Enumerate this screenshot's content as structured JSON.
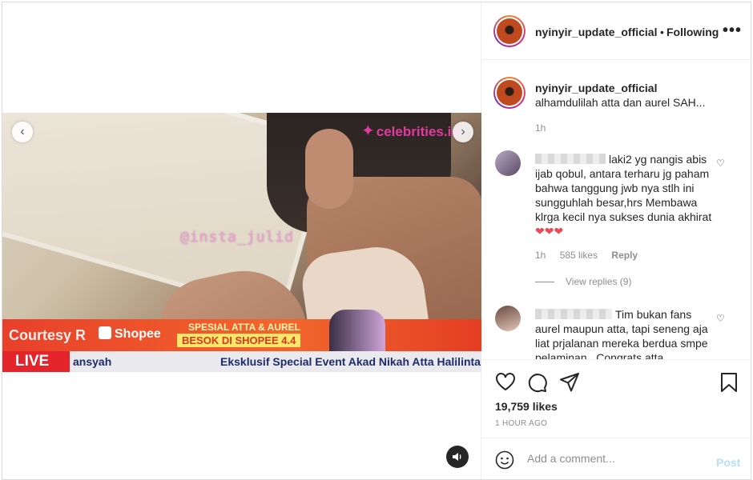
{
  "post": {
    "username": "nyinyir_update_official",
    "dot": "•",
    "follow_label": "Following",
    "more_label": "•••"
  },
  "video": {
    "watermark_site": "celebrities.id",
    "watermark_handle": "@insta_julid",
    "banner_courtesy": "Courtesy R",
    "banner_shopee": "Shopee",
    "promo_line1": "SPESIAL ATTA & AUREL",
    "promo_line2": "BESOK DI SHOPEE 4.4",
    "live_label": "LIVE",
    "ticker_left": "ansyah",
    "ticker_right": "Eksklusif Special Event Akad Nikah Atta Halilintar & Au"
  },
  "caption": {
    "username": "nyinyir_update_official",
    "text": "alhamdulilah atta dan aurel SAH...",
    "time": "1h"
  },
  "comments": [
    {
      "text": "laki2 yg nangis abis ijab qobul, antara terharu jg paham bahwa tanggung jwb nya stlh ini sungguhlah besar,hrs Membawa klrga kecil nya sukses dunia akhirat",
      "hearts": "❤❤❤",
      "time": "1h",
      "likes": "585 likes",
      "reply": "Reply",
      "view_replies": "View replies (9)"
    },
    {
      "text": "Tim bukan fans aurel maupun atta, tapi seneng aja liat prjalanan mereka berdua smpe pelaminan.. Congrats atta"
    }
  ],
  "likes_count": "19,759 likes",
  "posted_time": "1 HOUR AGO",
  "add_comment": {
    "placeholder": "Add a comment...",
    "post_label": "Post"
  },
  "colors": {
    "accent_disabled": "#b2dffc",
    "heart": "#ed4956",
    "live_red": "#e3242b"
  },
  "icons": [
    "heart-icon",
    "comment-icon",
    "share-icon",
    "bookmark-icon",
    "emoji-icon",
    "sound-icon",
    "chevron-left-icon",
    "chevron-right-icon"
  ]
}
